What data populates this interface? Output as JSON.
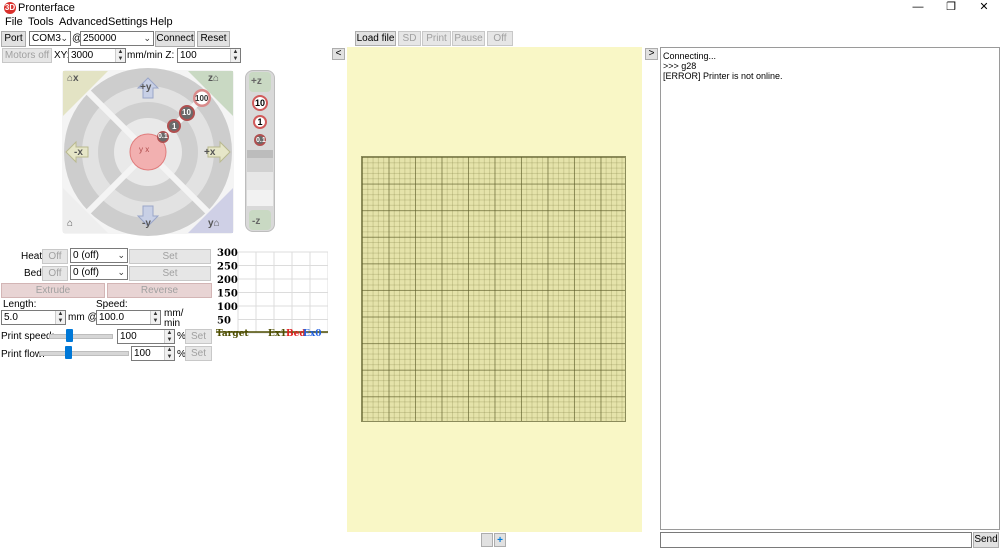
{
  "window": {
    "title": "Pronterface",
    "icon_text": "3D"
  },
  "menu": [
    "File",
    "Tools",
    "Advanced",
    "Settings",
    "Help"
  ],
  "connection": {
    "port_label": "Port",
    "port_value": "COM3",
    "at": "@",
    "baud_value": "250000",
    "connect_label": "Connect",
    "reset_label": "Reset"
  },
  "motion": {
    "motors_off_label": "Motors off",
    "xy_label": "XY:",
    "xy_value": "3000",
    "z_label": "mm/min Z:",
    "z_value": "100"
  },
  "jog": {
    "corner_labels": {
      "home_x": "x",
      "home_z": "z",
      "home_all": "",
      "home_y": "y"
    },
    "axis_labels": {
      "py": "+y",
      "ny": "-y",
      "nx": "-x",
      "px": "+x"
    },
    "steps": [
      "100",
      "10",
      "1",
      "0.1"
    ],
    "center": "y x",
    "z_labels": {
      "pz": "+z",
      "nz": "-z"
    },
    "z_steps": [
      "10",
      "1",
      "0.1"
    ]
  },
  "temps": {
    "heat_label": "Heat:",
    "heat_off": "Off",
    "heat_value": "0 (off)",
    "heat_set": "Set",
    "bed_label": "Bed:",
    "bed_off": "Off",
    "bed_value": "0 (off)",
    "bed_set": "Set"
  },
  "extrude": {
    "extrude_label": "Extrude",
    "reverse_label": "Reverse",
    "length_label": "Length:",
    "speed_label": "Speed:",
    "length_value": "5.0",
    "mm_at": "mm @",
    "speed_value": "100.0",
    "speed_unit_1": "mm/",
    "speed_unit_2": "min"
  },
  "print_speed": {
    "label": "Print speed:",
    "value": "100",
    "unit": "%",
    "set": "Set",
    "level": 0.33
  },
  "print_flow": {
    "label": "Print flow:",
    "value": "100",
    "unit": "%",
    "set": "Set",
    "level": 0.33
  },
  "chart_data": {
    "type": "line",
    "yticks": [
      "300",
      "250",
      "200",
      "150",
      "100",
      "50"
    ],
    "legend": [
      {
        "name": "Target",
        "color": "#4d4d00"
      },
      {
        "name": "Ex1",
        "color": "#4d4d00"
      },
      {
        "name": "Bed",
        "color": "#e02020"
      },
      {
        "name": "Ex0",
        "color": "#2060e0"
      }
    ],
    "series": []
  },
  "toolbar": {
    "load_file": "Load file",
    "sd": "SD",
    "print": "Print",
    "pause": "Pause",
    "off": "Off",
    "collapse_left": "<",
    "collapse_right": ">"
  },
  "log": {
    "lines": [
      "Connecting...",
      ">>> g28",
      "[ERROR] Printer is not online."
    ]
  },
  "command": {
    "value": "",
    "send_label": "Send"
  },
  "bottom": {
    "add_label": "+"
  }
}
